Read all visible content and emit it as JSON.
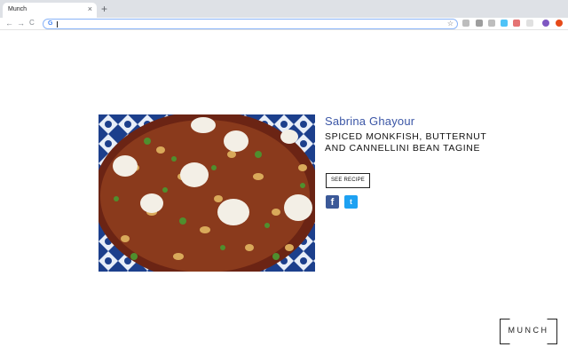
{
  "browser": {
    "tab_title": "Munch",
    "tab_close": "×",
    "new_tab": "+",
    "nav_back": "←",
    "nav_forward": "→",
    "nav_reload": "C",
    "omnibox_icon": "G",
    "bookmark_icon": "star-icon",
    "extension_colors": [
      "#bdbdbd",
      "#9e9e9e",
      "#bdbdbd",
      "#4fc3f7",
      "#e57373",
      "#e0e0e0",
      "#7e57c2",
      "#e64a19"
    ]
  },
  "recipe": {
    "author": "Sabrina Ghayour",
    "title": "SPICED MONKFISH, BUTTERNUT AND CANNELLINI BEAN TAGINE",
    "button_label": "SEE RECIPE",
    "facebook_glyph": "f",
    "twitter_glyph": "t"
  },
  "logo": {
    "text": "MUNCH"
  },
  "colors": {
    "author": "#3b56a6",
    "facebook": "#3b5998",
    "twitter": "#1da1f2"
  }
}
